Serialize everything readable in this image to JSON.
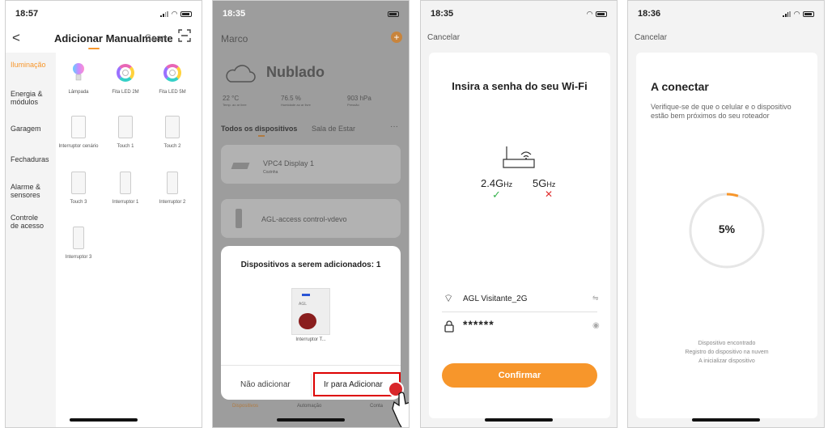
{
  "phone1": {
    "time": "18:57",
    "title": "Adicionar Manualmente",
    "scan": "Scan",
    "categories": [
      "Iluminação",
      "Energia & módulos",
      "Garagem",
      "Fechaduras",
      "Alarme & sensores",
      "Controle de acesso"
    ],
    "devices": [
      "Lâmpada",
      "Fita LED 2M",
      "Fita LED 5M",
      "Interruptor cenário",
      "Touch 1",
      "Touch 2",
      "Touch 3",
      "Interruptor 1",
      "Interruptor 2",
      "Interruptor 3"
    ]
  },
  "phone2": {
    "time": "18:35",
    "home": "Marco",
    "weather": "Nublado",
    "stats": [
      {
        "v": "22 °C",
        "l": "Temp. ao ar livre"
      },
      {
        "v": "76.5 %",
        "l": "Humidade ao ar livre"
      },
      {
        "v": "903 hPa",
        "l": "Pressão"
      }
    ],
    "tab_all": "Todos os dispositivos",
    "tab_room": "Sala de Estar",
    "dev1_name": "VPC4 Display 1",
    "dev1_room": "Cozinha",
    "dev2_name": "AGL-access control-vdevo",
    "sheet_title": "Dispositivos a serem adicionados: 1",
    "sheet_dev": "Interruptor T...",
    "logo": "AGL",
    "btn_no": "Não adicionar",
    "btn_yes": "Ir para Adicionar",
    "bottom": [
      "Dispositivos",
      "Automação",
      "Conta"
    ]
  },
  "phone3": {
    "time": "18:35",
    "cancel": "Cancelar",
    "title": "Insira a senha do seu Wi-Fi",
    "band24": "2.4G",
    "band24_unit": "Hz",
    "band5": "5G",
    "band5_unit": "Hz",
    "ssid": "AGL Visitante_2G",
    "password": "******",
    "confirm": "Confirmar"
  },
  "phone4": {
    "time": "18:36",
    "cancel": "Cancelar",
    "title": "A conectar",
    "desc": "Verifique-se de que o celular e o dispositivo estão bem próximos do seu roteador",
    "progress": 5,
    "progress_label": "5%",
    "steps": [
      "Dispositivo encontrado",
      "Registro do dispositivo na nuvem",
      "A inicializar dispositivo"
    ]
  }
}
